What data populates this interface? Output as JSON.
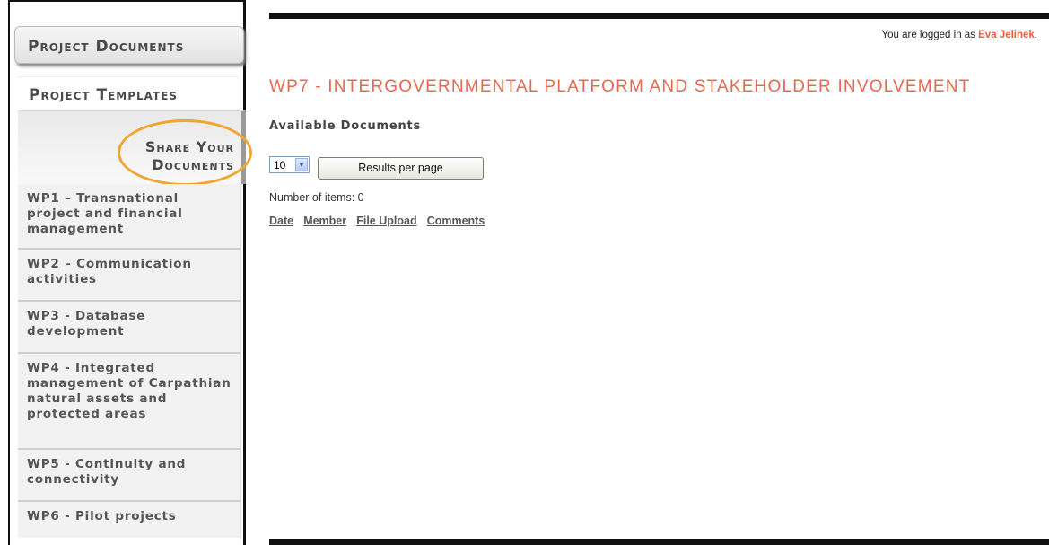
{
  "sidebar": {
    "project_documents": "Project Documents",
    "project_templates": "Project Templates",
    "share_line1": "Share Your",
    "share_line2": "Documents",
    "work_packages": [
      "WP1 – Transnational project and financial management",
      "WP2 – Communication activities",
      "WP3 - Database development",
      "WP4 - Integrated management of Carpathian natural assets and protected areas",
      "WP5 - Continuity and connectivity",
      "WP6 - Pilot projects"
    ]
  },
  "header": {
    "login_prefix": "You are logged in as ",
    "user_name": "Eva Jelinek",
    "login_suffix": "."
  },
  "main": {
    "title": "WP7 - INTERGOVERNMENTAL PLATFORM AND STAKEHOLDER INVOLVEMENT",
    "section_heading": "Available Documents",
    "per_page_value": "10",
    "per_page_button": "Results per page",
    "item_count": "Number of items: 0",
    "columns": [
      "Date",
      "Member",
      "File Upload",
      "Comments"
    ]
  },
  "colors": {
    "accent": "#e9674f",
    "highlight": "#f3a531",
    "sidebar_text": "#555555"
  }
}
